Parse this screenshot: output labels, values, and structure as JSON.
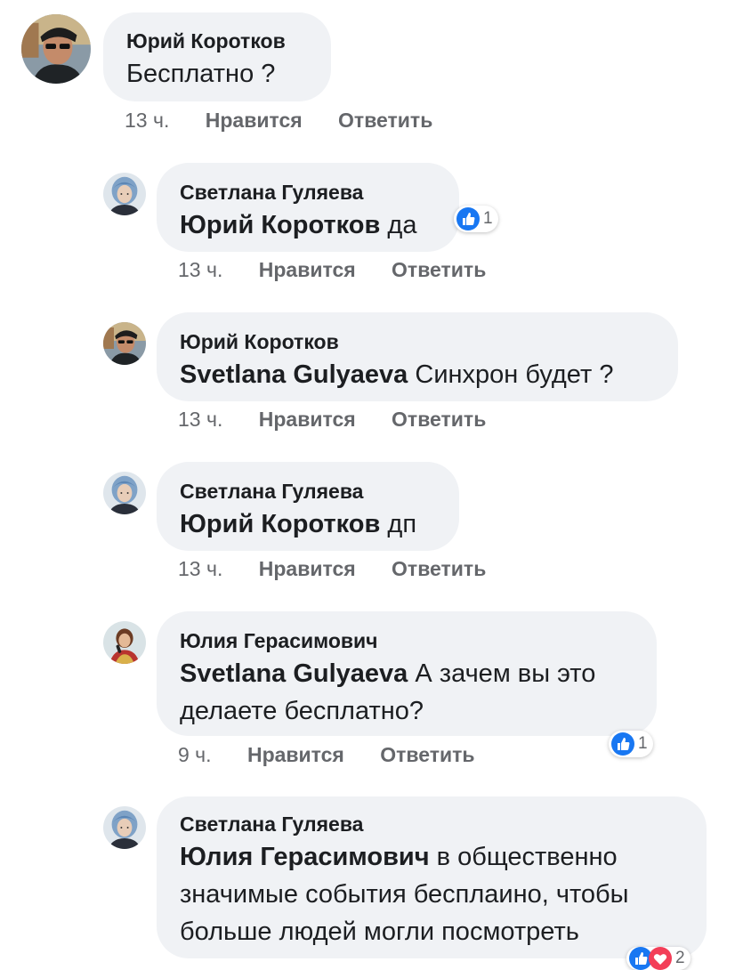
{
  "colors": {
    "bubble": "#f0f2f5",
    "meta_text": "#65676b",
    "like_blue": "#1877f2",
    "love_red": "#f33e58"
  },
  "comments": [
    {
      "author": "Юрий Коротков",
      "mention": "",
      "text": "Бесплатно ?",
      "time": "13 ч.",
      "like_label": "Нравится",
      "reply_label": "Ответить",
      "avatar_icon": "avatar-man-sunglasses"
    },
    {
      "author": "Светлана Гуляева",
      "mention": "Юрий Коротков",
      "text": "да",
      "time": "13 ч.",
      "like_label": "Нравится",
      "reply_label": "Ответить",
      "reactions": {
        "icons": [
          "like-icon"
        ],
        "count": "1"
      },
      "avatar_icon": "avatar-woman-blue-hair"
    },
    {
      "author": "Юрий Коротков",
      "mention": "Svetlana Gulyaeva",
      "text": "Синхрон будет ?",
      "time": "13 ч.",
      "like_label": "Нравится",
      "reply_label": "Ответить",
      "avatar_icon": "avatar-man-sunglasses"
    },
    {
      "author": "Светлана Гуляева",
      "mention": "Юрий Коротков",
      "text": "дп",
      "time": "13 ч.",
      "like_label": "Нравится",
      "reply_label": "Ответить",
      "avatar_icon": "avatar-woman-blue-hair"
    },
    {
      "author": "Юлия Герасимович",
      "mention": "Svetlana Gulyaeva",
      "text_line1": "А зачем вы это",
      "text_line2": "делаете бесплатно?",
      "time": "9 ч.",
      "like_label": "Нравится",
      "reply_label": "Ответить",
      "reactions": {
        "icons": [
          "like-icon"
        ],
        "count": "1"
      },
      "avatar_icon": "avatar-woman-microphone"
    },
    {
      "author": "Светлана Гуляева",
      "mention": "Юлия Герасимович",
      "text_line1": "в общественно",
      "text_line2": "значимые события бесплаино, чтобы",
      "text_line3": "больше людей могли посмотреть",
      "reactions": {
        "icons": [
          "like-icon",
          "love-icon"
        ],
        "count": "2"
      },
      "avatar_icon": "avatar-woman-blue-hair"
    }
  ]
}
